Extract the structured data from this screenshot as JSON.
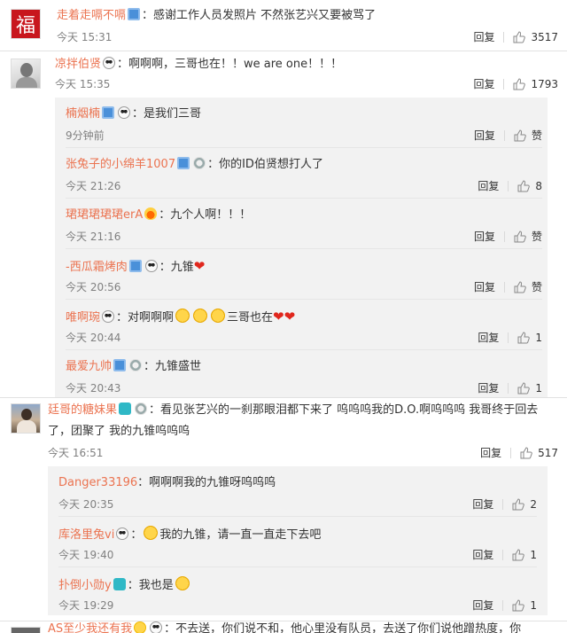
{
  "comments": [
    {
      "name": "走着走嗝不嗝",
      "text": "：感谢工作人员发照片 不然张艺兴又要被骂了",
      "time": "今天 15:31",
      "reply": "回复",
      "likes": "3517",
      "avatar_char": "福"
    },
    {
      "name": "凉拌伯贤",
      "text": "：啊啊啊，三哥也在！！we are  one！！！",
      "time": "今天 15:35",
      "reply": "回复",
      "likes": "1793",
      "replies": [
        {
          "name": "楠烟楠",
          "text": "：是我们三哥",
          "time": "9分钟前",
          "reply": "回复",
          "likes": "赞"
        },
        {
          "name": "张兔子的小绵羊1007",
          "text": "：你的ID伯贤想打人了",
          "time": "今天 21:26",
          "reply": "回复",
          "likes": "8"
        },
        {
          "name": "珺珺珺珺珺erA",
          "text": "：九个人啊！！！",
          "time": "今天 21:16",
          "reply": "回复",
          "likes": "赞"
        },
        {
          "name": "-西瓜霜烤肉",
          "text": "：九锥",
          "time": "今天 20:56",
          "reply": "回复",
          "likes": "赞"
        },
        {
          "name": "唯啊琬",
          "text": "：对啊啊啊",
          "text2": "三哥也在",
          "time": "今天 20:44",
          "reply": "回复",
          "likes": "1"
        },
        {
          "name": "最爱九帅",
          "text": "：九锥盛世",
          "time": "今天 20:43",
          "reply": "回复",
          "likes": "1"
        }
      ]
    },
    {
      "name": "廷哥的糖妹果",
      "text": "：看见张艺兴的一刹那眼泪都下来了 呜呜呜我的D.O.啊呜呜呜 我哥终于回去",
      "text_line2": "了，团聚了 我的九锥呜呜呜",
      "time": "今天 16:51",
      "reply": "回复",
      "likes": "517",
      "replies": [
        {
          "name": "Danger33196",
          "text": "：啊啊啊我的九锥呀呜呜呜",
          "time": "今天 20:35",
          "reply": "回复",
          "likes": "2"
        },
        {
          "name": "库洛里兔vi",
          "text": "我的九锥，请一直一直走下去吧",
          "time": "今天 19:40",
          "reply": "回复",
          "likes": "1"
        },
        {
          "name": "扑倒小勋y",
          "text": "：我也是",
          "time": "今天 19:29",
          "reply": "回复",
          "likes": "1"
        }
      ]
    },
    {
      "name": "AS至少我还有我",
      "text": "：不去送，你们说不和，他心里没有队员，去送了你们说他蹭热度，你"
    }
  ],
  "colors": {
    "name": "#eb7350",
    "time": "#808080",
    "sub_bg": "#f2f2f2",
    "heart": "#e0271d"
  }
}
